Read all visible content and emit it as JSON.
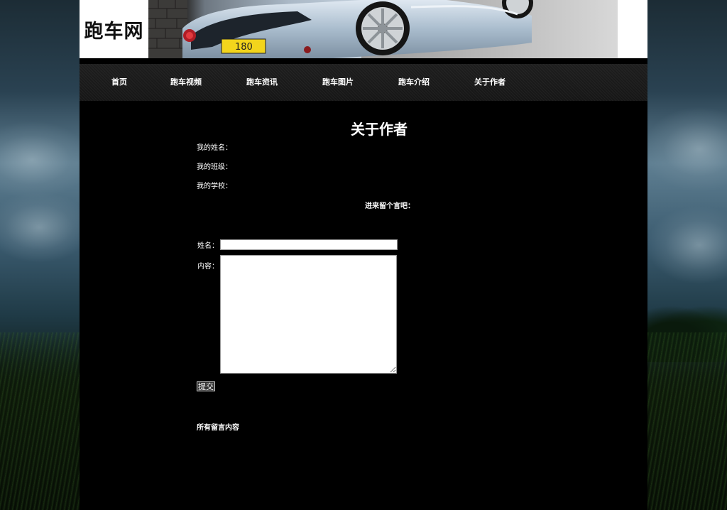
{
  "site": {
    "logo_text": "跑车网"
  },
  "nav": {
    "items": [
      {
        "label": "首页"
      },
      {
        "label": "跑车视频"
      },
      {
        "label": "跑车资讯"
      },
      {
        "label": "跑车图片"
      },
      {
        "label": "跑车介绍"
      },
      {
        "label": "关于作者"
      }
    ]
  },
  "banner": {
    "plate_text": "180"
  },
  "about": {
    "title": "关于作者",
    "name_label": "我的姓名：",
    "class_label": "我的班级：",
    "school_label": "我的学校：",
    "message_prompt": "进来留个言吧："
  },
  "form": {
    "name_label": "姓名：",
    "name_value": "",
    "content_label": "内容：",
    "content_value": "",
    "submit_label": "提交"
  },
  "messages": {
    "heading": "所有留言内容"
  },
  "colors": {
    "page_bg": "#000000",
    "header_bg": "#ffffff",
    "nav_bg": "#1a1a1a",
    "text": "#ffffff"
  }
}
